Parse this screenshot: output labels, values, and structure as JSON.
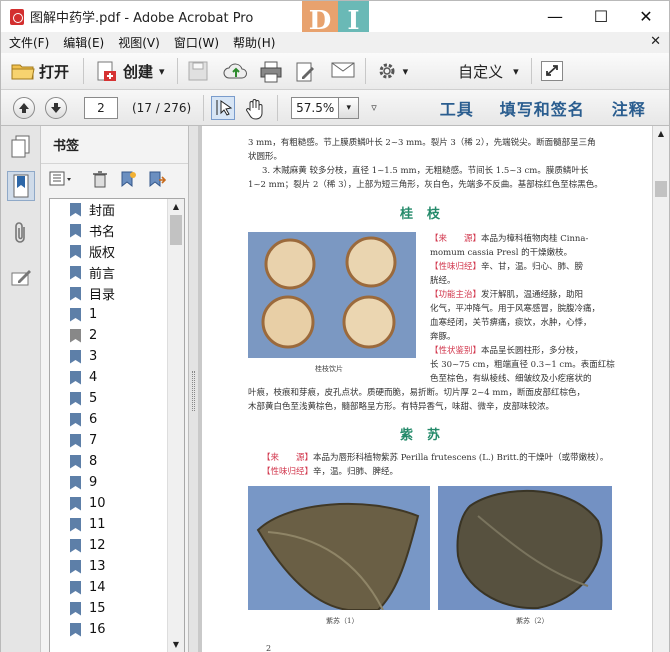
{
  "window": {
    "title": "图解中药学.pdf - Adobe Acrobat Pro",
    "logo_left": "D",
    "logo_right": "I",
    "minimize": "—",
    "maximize": "☐",
    "close": "✕"
  },
  "menu": {
    "items": [
      "文件(F)",
      "编辑(E)",
      "视图(V)",
      "窗口(W)",
      "帮助(H)"
    ],
    "close": "✕"
  },
  "toolbar": {
    "open_label": "打开",
    "create_label": "创建",
    "create_arrow": "▾",
    "settings_arrow": "▾",
    "custom_label": "自定义",
    "custom_arrow": "▾"
  },
  "nav": {
    "current_page": "2",
    "page_status": "(17 / 276)",
    "zoom": "57.5%",
    "zoom_arrow": "▾",
    "more": "▿",
    "tools": "工具",
    "fill_sign": "填写和签名",
    "comment": "注释"
  },
  "bookmarks": {
    "title": "书签",
    "items": [
      {
        "label": "封面",
        "flag": "blue"
      },
      {
        "label": "书名",
        "flag": "blue"
      },
      {
        "label": "版权",
        "flag": "blue"
      },
      {
        "label": "前言",
        "flag": "blue"
      },
      {
        "label": "目录",
        "flag": "blue"
      },
      {
        "label": "1",
        "flag": "blue"
      },
      {
        "label": "2",
        "flag": "grey"
      },
      {
        "label": "3",
        "flag": "blue"
      },
      {
        "label": "4",
        "flag": "blue"
      },
      {
        "label": "5",
        "flag": "blue"
      },
      {
        "label": "6",
        "flag": "blue"
      },
      {
        "label": "7",
        "flag": "blue"
      },
      {
        "label": "8",
        "flag": "blue"
      },
      {
        "label": "9",
        "flag": "blue"
      },
      {
        "label": "10",
        "flag": "blue"
      },
      {
        "label": "11",
        "flag": "blue"
      },
      {
        "label": "12",
        "flag": "blue"
      },
      {
        "label": "13",
        "flag": "blue"
      },
      {
        "label": "14",
        "flag": "blue"
      },
      {
        "label": "15",
        "flag": "blue"
      },
      {
        "label": "16",
        "flag": "blue"
      }
    ]
  },
  "document": {
    "para1_l1": "3 mm，有粗糙感。节上膜质鳞叶长 2~3 mm。裂片 3（稀 2），先端锐尖。断面髓部呈三角",
    "para1_l2": "状圆形。",
    "para2_l1": "3. 木贼麻黄   较多分枝，直径 1~1.5 mm，无粗糙感。节间长 1.5~3 cm。膜质鳞叶长",
    "para2_l2": "1~2 mm；裂片 2（稀 3），上部为短三角形，灰白色，先端多不反曲。基部棕红色至棕黑色。",
    "heading1": "桂枝",
    "guizhi_src_tag": "【来　　源】",
    "guizhi_src": "本品为樟科植物肉桂 Cinna-",
    "guizhi_src2": "momum cassia Presl 的干燥嫩枝。",
    "guizhi_prop_tag": "【性味归经】",
    "guizhi_prop": "辛、甘，温。归心、肺、膀",
    "guizhi_prop2": "胱经。",
    "guizhi_func_tag": "【功能主治】",
    "guizhi_func": "发汗解肌，温通经脉，助阳",
    "guizhi_func2": "化气，平冲降气。用于风寒感冒，脘腹冷痛，",
    "guizhi_func3": "血寒经闭，关节痹痛，痰饮，水肿，心悸，",
    "guizhi_func4": "奔豚。",
    "guizhi_shape_tag": "【性状鉴别】",
    "guizhi_shape": "本品呈长圆柱形，多分枝，",
    "guizhi_shape2": "长 30~75 cm，粗端直径 0.3~1 cm。表面红棕",
    "guizhi_shape3": "色至棕色，有纵棱线、细皱纹及小疙瘩状的",
    "guizhi_shape4": "叶痕，枝痕和芽痕，皮孔点状。质硬而脆，易折断。切片厚 2~4 mm，断面皮部红棕色，",
    "guizhi_shape5": "木部黄白色至浅黄棕色，髓部略呈方形。有特异香气，味甜、微辛，皮部味较浓。",
    "guizhi_caption": "桂枝饮片",
    "heading2": "紫苏",
    "zisu_src_tag": "【来　　源】",
    "zisu_src": "本品为唇形科植物紫苏 Perilla frutescens (L.) Britt.的干燥叶（或带嫩枝）。",
    "zisu_prop_tag": "【性味归经】",
    "zisu_prop": "辛，温。归肺、脾经。",
    "zisu_caption1": "紫苏（1）",
    "zisu_caption2": "紫苏（2）",
    "page_number": "2"
  }
}
